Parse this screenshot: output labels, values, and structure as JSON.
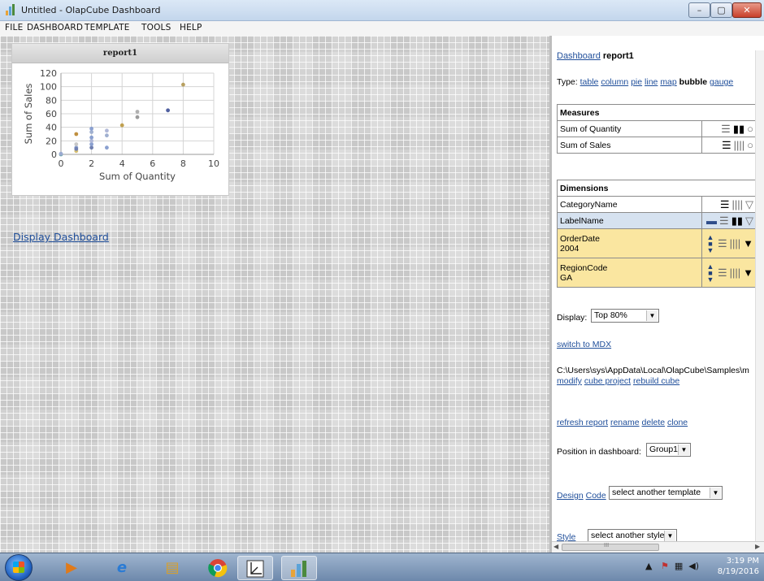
{
  "window": {
    "title": "Untitled - OlapCube Dashboard",
    "min": "–",
    "max": "▢",
    "close": "✕"
  },
  "menu": [
    "FILE",
    "DASHBOARD",
    "TEMPLATE",
    "TOOLS",
    "HELP"
  ],
  "report": {
    "title": "report1",
    "chart_data": {
      "type": "scatter",
      "xlabel": "Sum of Quantity",
      "ylabel": "Sum of Sales",
      "xlim": [
        0,
        10
      ],
      "ylim": [
        0,
        120
      ],
      "xticks": [
        0,
        2,
        4,
        6,
        8,
        10
      ],
      "yticks": [
        0,
        20,
        40,
        60,
        80,
        100,
        120
      ],
      "grid": true,
      "points": [
        {
          "x": 0,
          "y": 0,
          "color": "#6aa0a8"
        },
        {
          "x": 0,
          "y": 1,
          "color": "#9aaad0"
        },
        {
          "x": 1,
          "y": 5,
          "color": "#d8c070"
        },
        {
          "x": 1,
          "y": 10,
          "color": "#8aa0d0"
        },
        {
          "x": 1,
          "y": 15,
          "color": "#c8c8c8"
        },
        {
          "x": 1,
          "y": 30,
          "color": "#c09040"
        },
        {
          "x": 1,
          "y": 8,
          "color": "#7080b0"
        },
        {
          "x": 2,
          "y": 10,
          "color": "#7080b0"
        },
        {
          "x": 2,
          "y": 15,
          "color": "#8aa0d0"
        },
        {
          "x": 2,
          "y": 20,
          "color": "#b0b8d8"
        },
        {
          "x": 2,
          "y": 25,
          "color": "#8aa0d0"
        },
        {
          "x": 2,
          "y": 33,
          "color": "#a0b0d0"
        },
        {
          "x": 2,
          "y": 38,
          "color": "#8aa0d0"
        },
        {
          "x": 3,
          "y": 10,
          "color": "#8aa0d0"
        },
        {
          "x": 3,
          "y": 28,
          "color": "#a0b0d0"
        },
        {
          "x": 3,
          "y": 35,
          "color": "#b0b8d8"
        },
        {
          "x": 4,
          "y": 43,
          "color": "#c0a050"
        },
        {
          "x": 5,
          "y": 55,
          "color": "#9a9a9a"
        },
        {
          "x": 5,
          "y": 63,
          "color": "#b0b0b0"
        },
        {
          "x": 7,
          "y": 65,
          "color": "#5060a0"
        },
        {
          "x": 8,
          "y": 103,
          "color": "#b8a060"
        }
      ]
    }
  },
  "display_dashboard": "Display Dashboard",
  "panel": {
    "breadcrumb_link": "Dashboard",
    "breadcrumb_current": "report1",
    "type_label": "Type:",
    "types": [
      "table",
      "column",
      "pie",
      "line",
      "map"
    ],
    "type_selected": "bubble",
    "type_after": "gauge",
    "measures_header": "Measures",
    "measures": [
      "Sum of Quantity",
      "Sum of Sales"
    ],
    "dimensions_header": "Dimensions",
    "dimensions": [
      {
        "name": "CategoryName",
        "value": ""
      },
      {
        "name": "LabelName",
        "value": ""
      },
      {
        "name": "OrderDate",
        "value": "2004"
      },
      {
        "name": "RegionCode",
        "value": "GA"
      }
    ],
    "display_label": "Display:",
    "display_value": "Top 80%",
    "switch_mdx": "switch to MDX",
    "path": "C:\\Users\\sys\\AppData\\Local\\OlapCube\\Samples\\m",
    "modify": "modify",
    "cube_project": "cube project",
    "rebuild_cube": "rebuild cube",
    "refresh_report": "refresh report",
    "rename": "rename",
    "delete": "delete",
    "clone": "clone",
    "position_label": "Position in dashboard:",
    "position_value": "Group1",
    "design": "Design",
    "code": "Code",
    "template_value": "select another template",
    "style_label": "Style",
    "style_value": "select another style",
    "hscroll_mark": "III"
  },
  "taskbar": {
    "apps": [
      "windows-media-player",
      "internet-explorer",
      "file-explorer",
      "chrome",
      "axis-tool",
      "olapcube"
    ],
    "time": "3:19 PM",
    "date": "8/19/2016"
  }
}
